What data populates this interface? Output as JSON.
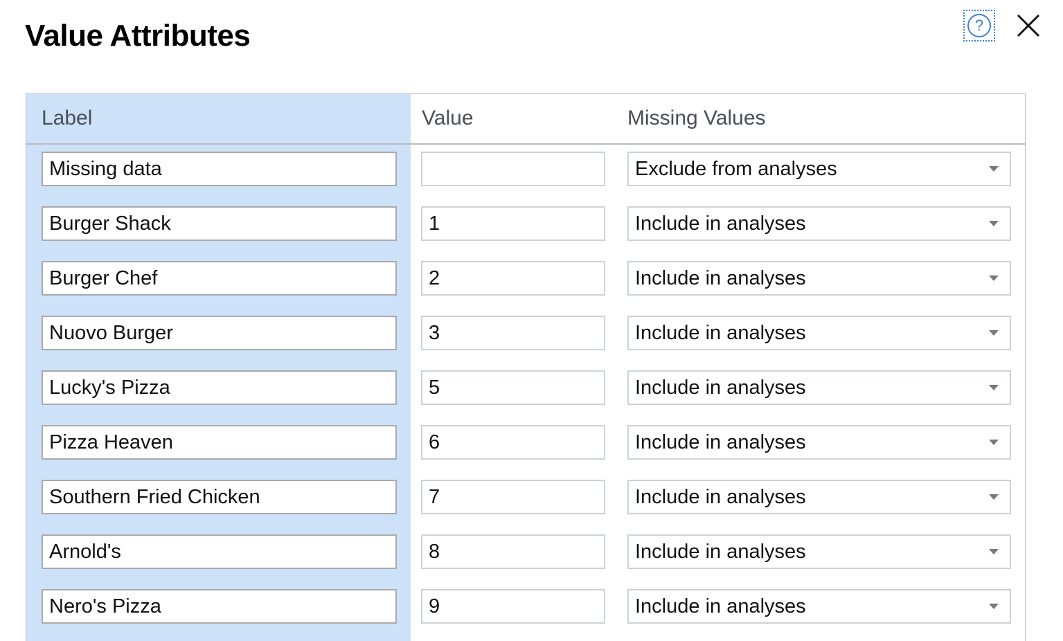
{
  "dialog": {
    "title": "Value Attributes"
  },
  "titlebar": {
    "help_icon": "help-circle-icon",
    "help_glyph": "?",
    "close_icon": "close-icon"
  },
  "table": {
    "columns": {
      "label": "Label",
      "value": "Value",
      "missing": "Missing Values"
    },
    "rows": [
      {
        "label": "Missing data",
        "value": "",
        "missing": "Exclude from analyses"
      },
      {
        "label": "Burger Shack",
        "value": "1",
        "missing": "Include in analyses"
      },
      {
        "label": "Burger Chef",
        "value": "2",
        "missing": "Include in analyses"
      },
      {
        "label": "Nuovo Burger",
        "value": "3",
        "missing": "Include in analyses"
      },
      {
        "label": "Lucky's Pizza",
        "value": "5",
        "missing": "Include in analyses"
      },
      {
        "label": "Pizza Heaven",
        "value": "6",
        "missing": "Include in analyses"
      },
      {
        "label": "Southern Fried Chicken",
        "value": "7",
        "missing": "Include in analyses"
      },
      {
        "label": "Arnold's",
        "value": "8",
        "missing": "Include in analyses"
      },
      {
        "label": "Nero's Pizza",
        "value": "9",
        "missing": "Include in analyses"
      }
    ],
    "missing_options": [
      "Include in analyses",
      "Exclude from analyses"
    ]
  },
  "colors": {
    "selected_column": "#cde2f9",
    "accent": "#3d7fd1",
    "header_text": "#4a4f58",
    "border": "#b9bcc0"
  }
}
